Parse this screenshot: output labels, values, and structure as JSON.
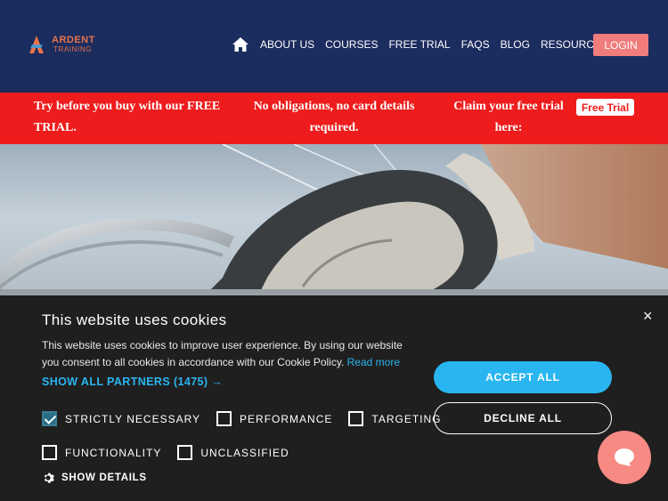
{
  "brand": {
    "name": "ARDENT",
    "tagline": "TRAINING"
  },
  "nav": {
    "items": [
      "ABOUT US",
      "COURSES",
      "FREE TRIAL",
      "FAQS",
      "BLOG",
      "RESOURCES"
    ],
    "login_label": "LOGIN"
  },
  "promo": {
    "text1": "Try before you buy with our FREE TRIAL.",
    "text2": "No obligations, no card details required.",
    "text3": "Claim your free trial here:",
    "button_label": "Free Trial"
  },
  "cookie": {
    "title": "This website uses cookies",
    "body": "This website uses cookies to improve user experience. By using our website you consent to all cookies in accordance with our Cookie Policy. ",
    "read_more": "Read more",
    "partners": "SHOW ALL PARTNERS (1475) →",
    "options": [
      {
        "label": "STRICTLY NECESSARY",
        "checked": true
      },
      {
        "label": "PERFORMANCE",
        "checked": false
      },
      {
        "label": "TARGETING",
        "checked": false
      },
      {
        "label": "FUNCTIONALITY",
        "checked": false
      },
      {
        "label": "UNCLASSIFIED",
        "checked": false
      }
    ],
    "show_details": "SHOW DETAILS",
    "accept_label": "ACCEPT ALL",
    "decline_label": "DECLINE ALL",
    "close_symbol": "×"
  },
  "colors": {
    "header_bg": "#1b2c5e",
    "promo_bg": "#ee1c1c",
    "accent": "#29b6f0",
    "login_bg": "#f07c7c",
    "chat_bg": "#f88a84"
  }
}
